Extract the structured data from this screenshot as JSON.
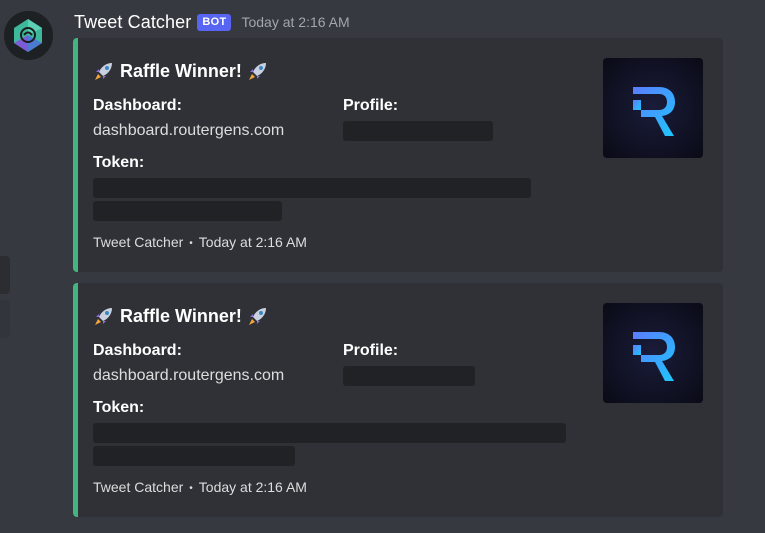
{
  "message": {
    "username": "Tweet Catcher",
    "bot_tag": "BOT",
    "timestamp": "Today at 2:16 AM"
  },
  "embeds": [
    {
      "title": "Raffle Winner!",
      "fields": {
        "dashboard_label": "Dashboard:",
        "dashboard_value": "dashboard.routergens.com",
        "profile_label": "Profile:",
        "token_label": "Token:"
      },
      "footer": {
        "author": "Tweet Catcher",
        "separator": "•",
        "time": "Today at 2:16 AM"
      },
      "accent_color": "#43b581",
      "thumbnail": "router-r-logo"
    },
    {
      "title": "Raffle Winner!",
      "fields": {
        "dashboard_label": "Dashboard:",
        "dashboard_value": "dashboard.routergens.com",
        "profile_label": "Profile:",
        "token_label": "Token:"
      },
      "footer": {
        "author": "Tweet Catcher",
        "separator": "•",
        "time": "Today at 2:16 AM"
      },
      "accent_color": "#43b581",
      "thumbnail": "router-r-logo"
    }
  ],
  "icons": {
    "title_decoration": "rocket-icon",
    "avatar": "bot-avatar-icon"
  }
}
